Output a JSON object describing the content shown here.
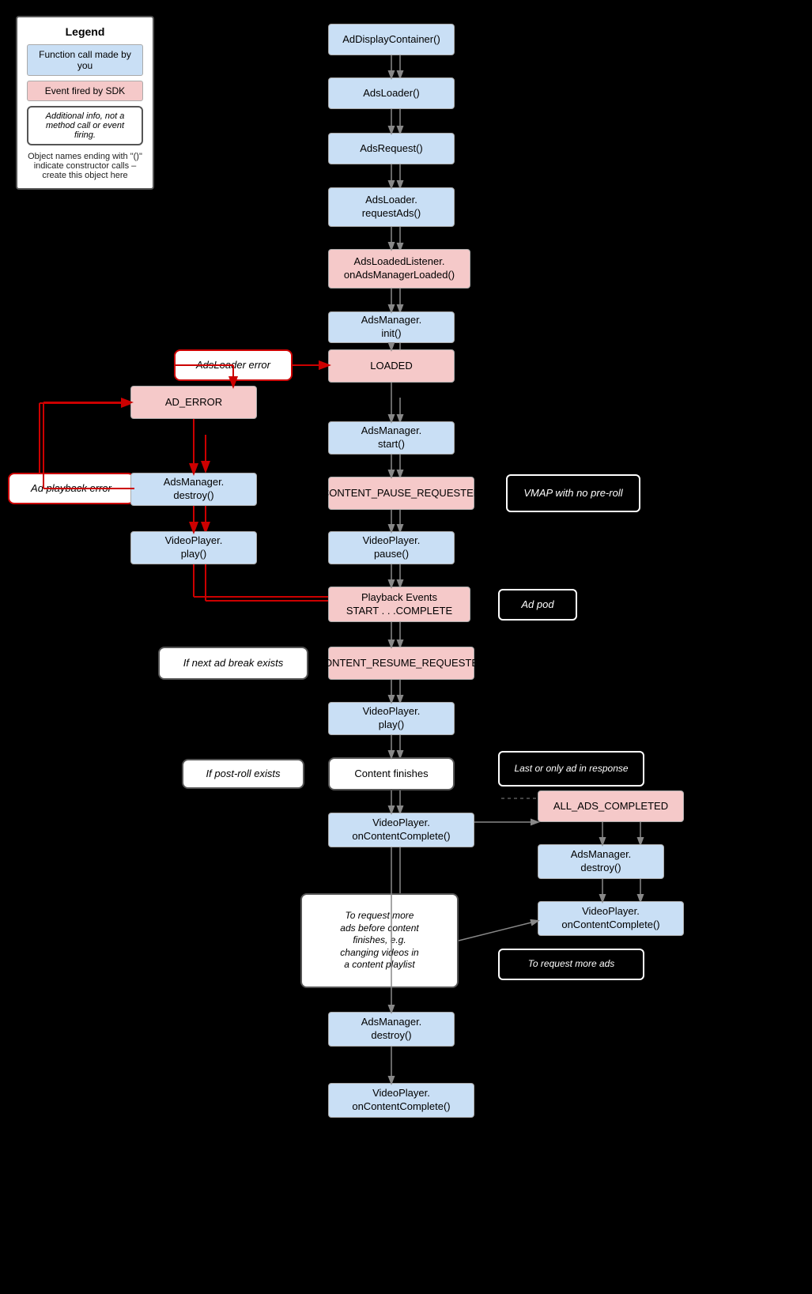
{
  "legend": {
    "title": "Legend",
    "item1": "Function call made by you",
    "item2": "Event fired by SDK",
    "item3": "Additional info, not a method call or event firing.",
    "note": "Object names ending with \"()\" indicate constructor calls – create this object here"
  },
  "boxes": {
    "adDisplayContainer": "AdDisplayContainer()",
    "adsLoader": "AdsLoader()",
    "adsRequest": "AdsRequest()",
    "adsLoaderRequestAds": "AdsLoader.\nrequestAds()",
    "adsLoadedListener": "AdsLoadedListener.\nonAdsManagerLoaded()",
    "adsManagerInit": "AdsManager.\ninit()",
    "adsLoaderError": "AdsLoader error",
    "loaded": "LOADED",
    "adError": "AD_ERROR",
    "adsManagerStart": "AdsManager.\nstart()",
    "adPlaybackError": "Ad playback error",
    "adsManagerDestroy1": "AdsManager.\ndestroy()",
    "contentPauseRequested": "CONTENT_PAUSE_REQUESTED",
    "vmapNoPreroll": "VMAP with no pre-roll",
    "videoPlayerPlay1": "VideoPlayer.\nplay()",
    "videoPlayerPause": "VideoPlayer.\npause()",
    "playbackEvents": "Playback Events\nSTART . . .COMPLETE",
    "adPod": "Ad pod",
    "ifNextAdBreak": "If next ad break exists",
    "contentResumeRequested": "CONTENT_RESUME_REQUESTED",
    "videoPlayerPlay2": "VideoPlayer.\nplay()",
    "lastOrOnlyAd": "Last or only ad in response",
    "ifPostRollExists": "If post-roll exists",
    "contentFinishes": "Content finishes",
    "allAdsCompleted": "ALL_ADS_COMPLETED",
    "videoPlayerOnContentComplete1": "VideoPlayer.\nonContentComplete()",
    "adsManagerDestroy2": "AdsManager.\ndestroy()",
    "videoPlayerOnContentComplete2": "VideoPlayer.\nonContentComplete()",
    "toRequestMoreAds": "To request more\nads before content\nfinishes, e.g.\nchanging videos in\na content playlist",
    "toRequestMoreAdsLabel": "To request more ads",
    "adsManagerDestroy3": "AdsManager.\ndestroy()",
    "videoPlayerOnContentComplete3": "VideoPlayer.\nonContentComplete()"
  }
}
